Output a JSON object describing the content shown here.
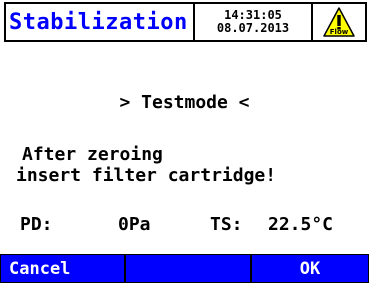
{
  "header": {
    "title": "Stabilization",
    "time": "14:31:05",
    "date": "08.07.2013",
    "warning_icon": "warning-triangle",
    "warning_label": "Flow",
    "colors": {
      "title": "#0000ff",
      "warning_fill": "#ffff00"
    }
  },
  "main": {
    "mode": "> Testmode <",
    "message_line1": "After zeroing",
    "message_line2": "insert filter cartridge!"
  },
  "readings": {
    "pd_label": "PD:",
    "pd_value": "0Pa",
    "ts_label": "TS:",
    "ts_value": "22.5°C"
  },
  "softkeys": {
    "left_label": "Cancel",
    "middle_label": "",
    "right_label": "OK",
    "colors": {
      "background": "#0000ff",
      "text": "#ffffff"
    }
  }
}
